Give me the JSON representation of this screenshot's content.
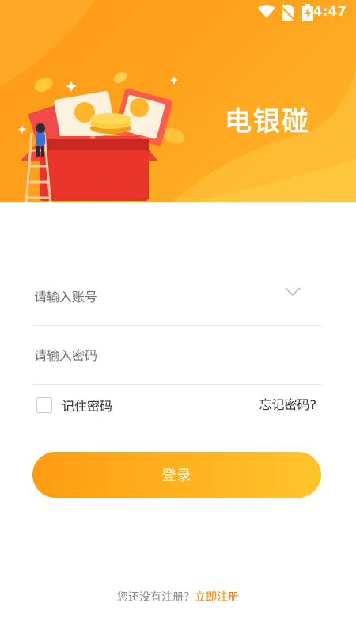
{
  "status_bar": {
    "time": "4:47",
    "icons": [
      "wifi-icon",
      "no-sim-icon",
      "battery-charging-icon"
    ]
  },
  "header": {
    "app_title": "电银碰"
  },
  "form": {
    "account": {
      "placeholder": "请输入账号",
      "value": ""
    },
    "password": {
      "placeholder": "请输入密码",
      "value": ""
    },
    "remember": {
      "label": "记住密码",
      "checked": false
    },
    "forgot_label": "忘记密码?",
    "login_label": "登录"
  },
  "footer": {
    "prompt": "您还没有注册？",
    "register_link": "立即注册"
  },
  "colors": {
    "brand_orange": "#ffa21c",
    "button_start": "#ff9c12",
    "button_end": "#ffc52a",
    "link": "#f27a00"
  }
}
